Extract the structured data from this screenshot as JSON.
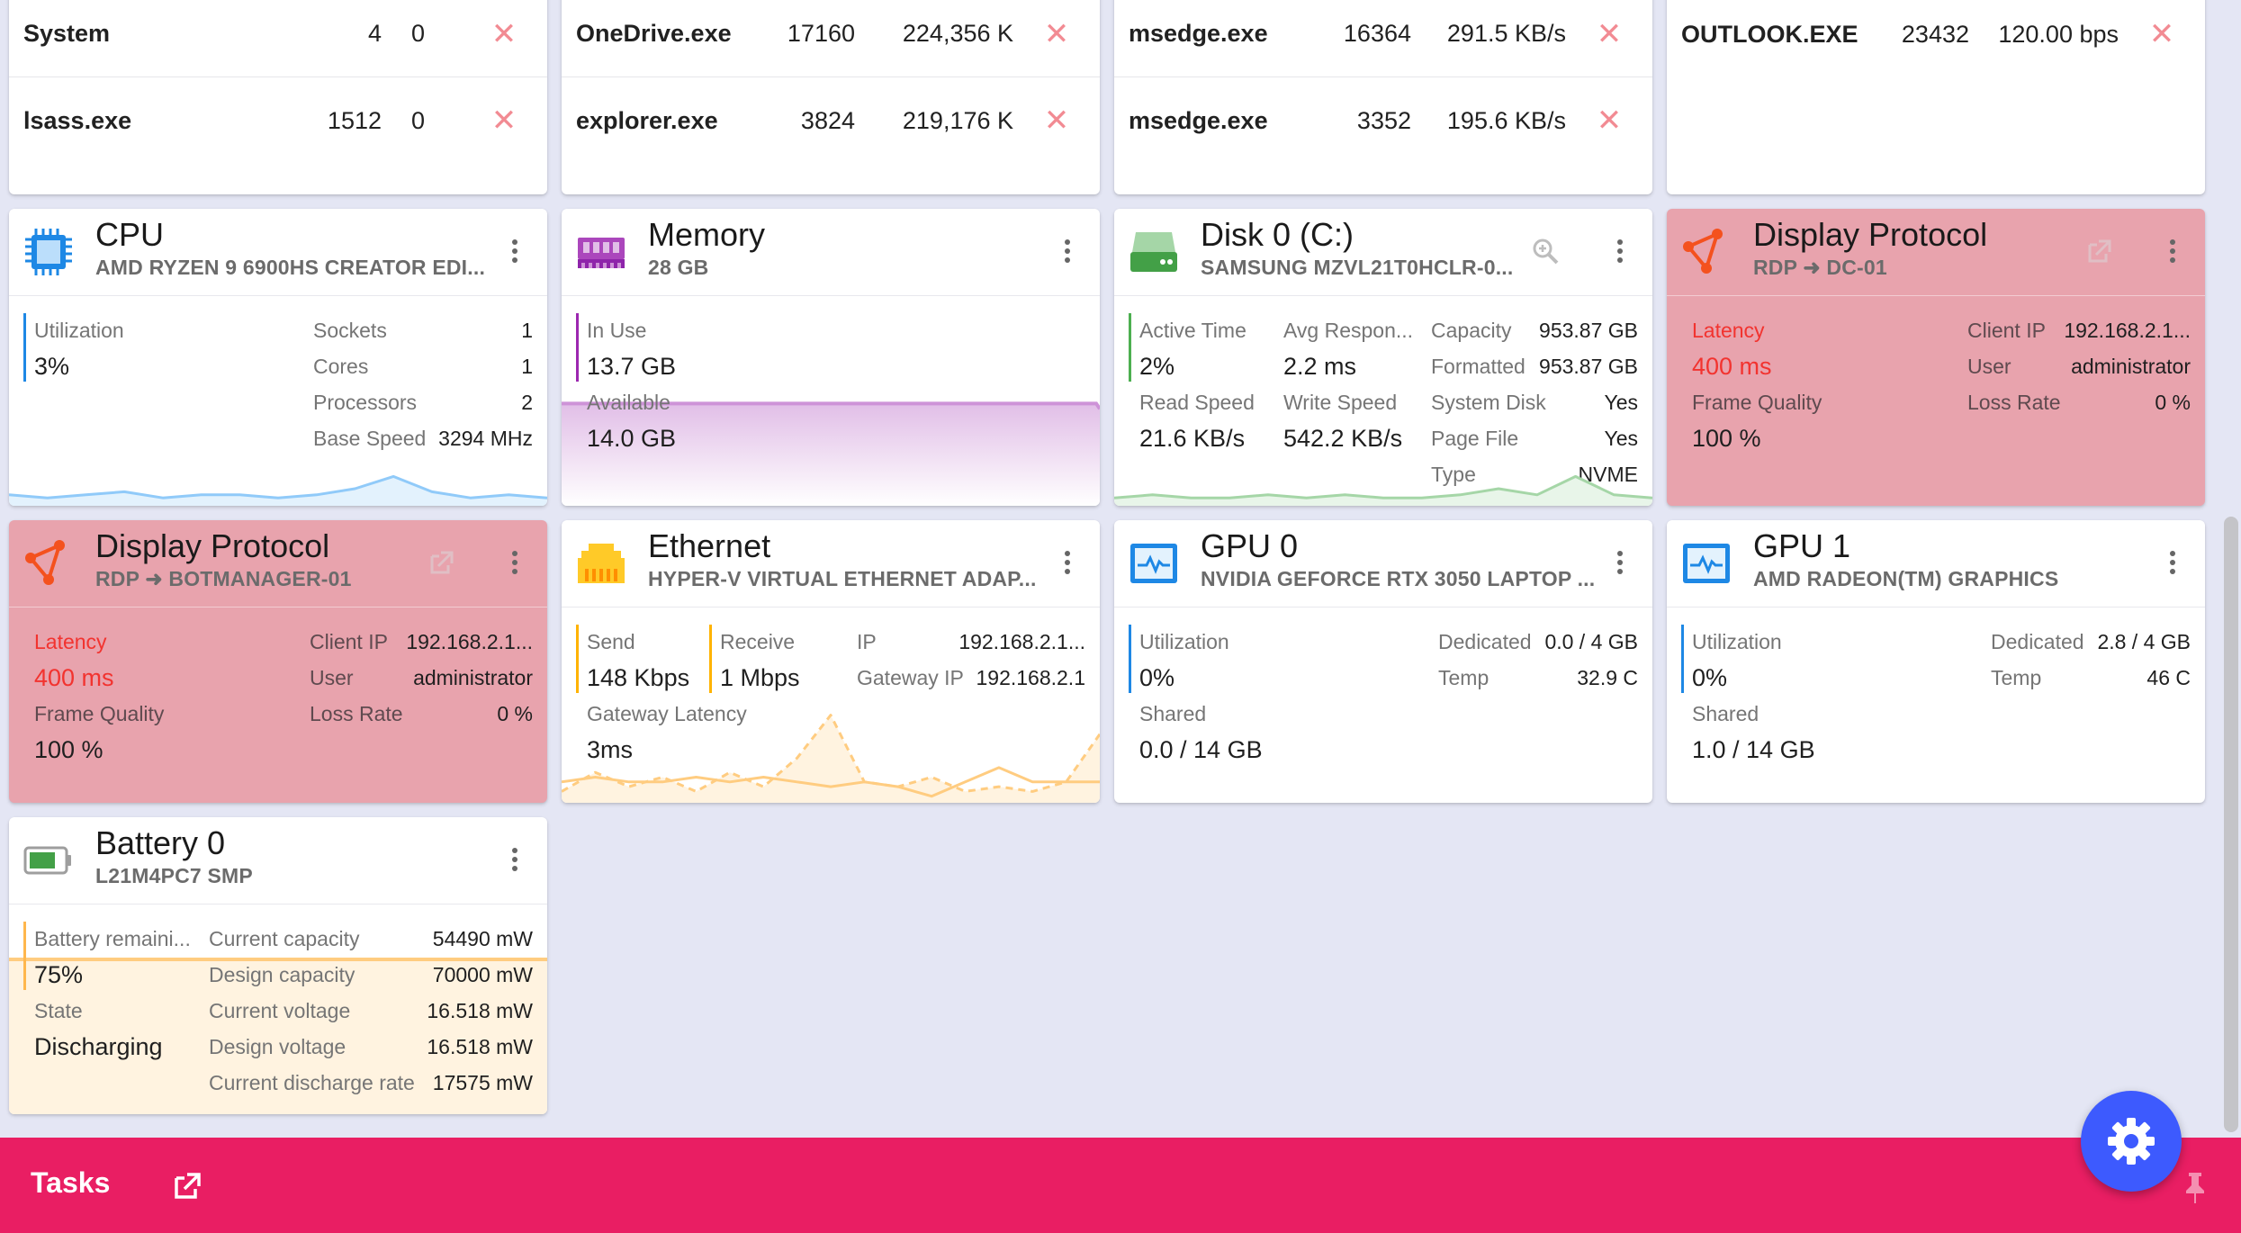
{
  "processes": {
    "cpu": [
      {
        "name": "System",
        "pid": "4",
        "value": "0"
      },
      {
        "name": "lsass.exe",
        "pid": "1512",
        "value": "0"
      }
    ],
    "memory": [
      {
        "name": "OneDrive.exe",
        "pid": "17160",
        "value": "224,356 K"
      },
      {
        "name": "explorer.exe",
        "pid": "3824",
        "value": "219,176 K"
      }
    ],
    "disk": [
      {
        "name": "msedge.exe",
        "pid": "16364",
        "value": "291.5 KB/s"
      },
      {
        "name": "msedge.exe",
        "pid": "3352",
        "value": "195.6 KB/s"
      }
    ],
    "network": [
      {
        "name": "OUTLOOK.EXE",
        "pid": "23432",
        "value": "120.00 bps"
      }
    ],
    "kill_glyph": "✕"
  },
  "cpu": {
    "title": "CPU",
    "subtitle": "AMD RYZEN 9 6900HS CREATOR EDI...",
    "utilization_label": "Utilization",
    "utilization": "3%",
    "sockets_label": "Sockets",
    "sockets": "1",
    "cores_label": "Cores",
    "cores": "1",
    "processors_label": "Processors",
    "processors": "2",
    "base_speed_label": "Base Speed",
    "base_speed": "3294 MHz",
    "accent": "#1e88e5",
    "graph": [
      3,
      2,
      3,
      4,
      2,
      3,
      3,
      2,
      3,
      5,
      9,
      4,
      2,
      3,
      2
    ]
  },
  "memory": {
    "title": "Memory",
    "subtitle": "28 GB",
    "in_use_label": "In Use",
    "in_use": "13.7 GB",
    "available_label": "Available",
    "available": "14.0 GB",
    "accent": "#9c27b0",
    "usage_fraction": 0.49
  },
  "disk": {
    "title": "Disk 0 (C:)",
    "subtitle": "SAMSUNG MZVL21T0HCLR-0...",
    "active_time_label": "Active Time",
    "active_time": "2%",
    "avg_response_label": "Avg Respon...",
    "avg_response": "2.2 ms",
    "read_speed_label": "Read Speed",
    "read_speed": "21.6 KB/s",
    "write_speed_label": "Write Speed",
    "write_speed": "542.2 KB/s",
    "capacity_label": "Capacity",
    "capacity": "953.87 GB",
    "formatted_label": "Formatted",
    "formatted": "953.87 GB",
    "system_disk_label": "System Disk",
    "system_disk": "Yes",
    "page_file_label": "Page File",
    "page_file": "Yes",
    "type_label": "Type",
    "type": "NVME",
    "accent": "#4caf50",
    "graph": [
      2,
      3,
      2,
      2,
      3,
      2,
      3,
      2,
      2,
      3,
      5,
      3,
      9,
      3,
      2
    ]
  },
  "display1": {
    "title": "Display Protocol",
    "subtitle": "RDP ➜ DC-01",
    "latency_label": "Latency",
    "latency": "400 ms",
    "frame_quality_label": "Frame Quality",
    "frame_quality": "100 %",
    "client_ip_label": "Client IP",
    "client_ip": "192.168.2.1...",
    "user_label": "User",
    "user": "administrator",
    "loss_rate_label": "Loss Rate",
    "loss_rate": "0 %"
  },
  "display2": {
    "title": "Display Protocol",
    "subtitle": "RDP ➜ BOTMANAGER-01",
    "latency_label": "Latency",
    "latency": "400 ms",
    "frame_quality_label": "Frame Quality",
    "frame_quality": "100 %",
    "client_ip_label": "Client IP",
    "client_ip": "192.168.2.1...",
    "user_label": "User",
    "user": "administrator",
    "loss_rate_label": "Loss Rate",
    "loss_rate": "0 %"
  },
  "ethernet": {
    "title": "Ethernet",
    "subtitle": "HYPER-V VIRTUAL ETHERNET ADAP...",
    "send_label": "Send",
    "send": "148 Kbps",
    "receive_label": "Receive",
    "receive": "1 Mbps",
    "gateway_latency_label": "Gateway Latency",
    "gateway_latency": "3ms",
    "ip_label": "IP",
    "ip": "192.168.2.1...",
    "gateway_ip_label": "Gateway IP",
    "gateway_ip": "192.168.2.1",
    "accent": "#ffb300",
    "graph_send": [
      4,
      5,
      4,
      4,
      5,
      4,
      5,
      4,
      3,
      4,
      3,
      1,
      4,
      7,
      4,
      4,
      4
    ],
    "graph_receive": [
      2,
      6,
      3,
      5,
      2,
      6,
      3,
      9,
      18,
      4,
      3,
      5,
      2,
      3,
      2,
      4,
      14
    ]
  },
  "gpu0": {
    "title": "GPU 0",
    "subtitle": "NVIDIA GEFORCE RTX 3050 LAPTOP ...",
    "utilization_label": "Utilization",
    "utilization": "0%",
    "shared_label": "Shared",
    "shared": "0.0 / 14 GB",
    "dedicated_label": "Dedicated",
    "dedicated": "0.0 / 4 GB",
    "temp_label": "Temp",
    "temp": "32.9 C"
  },
  "gpu1": {
    "title": "GPU 1",
    "subtitle": "AMD RADEON(TM) GRAPHICS",
    "utilization_label": "Utilization",
    "utilization": "0%",
    "shared_label": "Shared",
    "shared": "1.0 / 14 GB",
    "dedicated_label": "Dedicated",
    "dedicated": "2.8 / 4 GB",
    "temp_label": "Temp",
    "temp": "46 C"
  },
  "battery": {
    "title": "Battery 0",
    "subtitle": "L21M4PC7 SMP",
    "remaining_label": "Battery remaini...",
    "remaining": "75%",
    "state_label": "State",
    "state": "Discharging",
    "current_capacity_label": "Current capacity",
    "current_capacity": "54490 mW",
    "design_capacity_label": "Design capacity",
    "design_capacity": "70000 mW",
    "current_voltage_label": "Current voltage",
    "current_voltage": "16.518 mW",
    "design_voltage_label": "Design voltage",
    "design_voltage": "16.518 mW",
    "discharge_rate_label": "Current discharge rate",
    "discharge_rate": "17575 mW",
    "accent": "#ffb74d",
    "level_fraction": 0.75
  },
  "taskbar": {
    "label": "Tasks",
    "color": "#e91e63"
  },
  "icons": {
    "cpu": "cpu-chip-icon",
    "memory": "memory-module-icon",
    "disk": "hard-drive-icon",
    "display": "share-nodes-icon",
    "ethernet": "ethernet-port-icon",
    "gpu": "monitor-pulse-icon",
    "battery": "battery-icon",
    "settings": "gear-icon",
    "external": "open-external-icon",
    "zoom": "zoom-in-icon",
    "pin": "pin-icon"
  }
}
